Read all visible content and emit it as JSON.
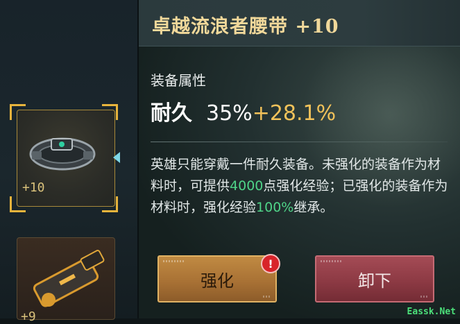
{
  "inventory": {
    "selected": {
      "name": "belt-item",
      "level": "+10"
    },
    "next": {
      "name": "gun-item",
      "level": "+9"
    }
  },
  "detail": {
    "title": "卓越流浪者腰带 +10",
    "attr_heading": "装备属性",
    "stat": {
      "name": "耐久",
      "base": "35%",
      "bonus": "+28.1%"
    },
    "desc": {
      "p1": "英雄只能穿戴一件耐久装备。未强化的装备作为材料时，可提供",
      "hl1": "4000",
      "p2": "点强化经验；已强化的装备作为材料时，强化经验",
      "hl2": "100%",
      "p3": "继承。"
    },
    "buttons": {
      "enhance": "强化",
      "unequip": "卸下"
    },
    "alert_badge": "!"
  },
  "watermark": "Eassk.Net",
  "colors": {
    "accent_gold": "#f2c25a",
    "highlight_green": "#4fd488",
    "alert_red": "#d8242a"
  }
}
